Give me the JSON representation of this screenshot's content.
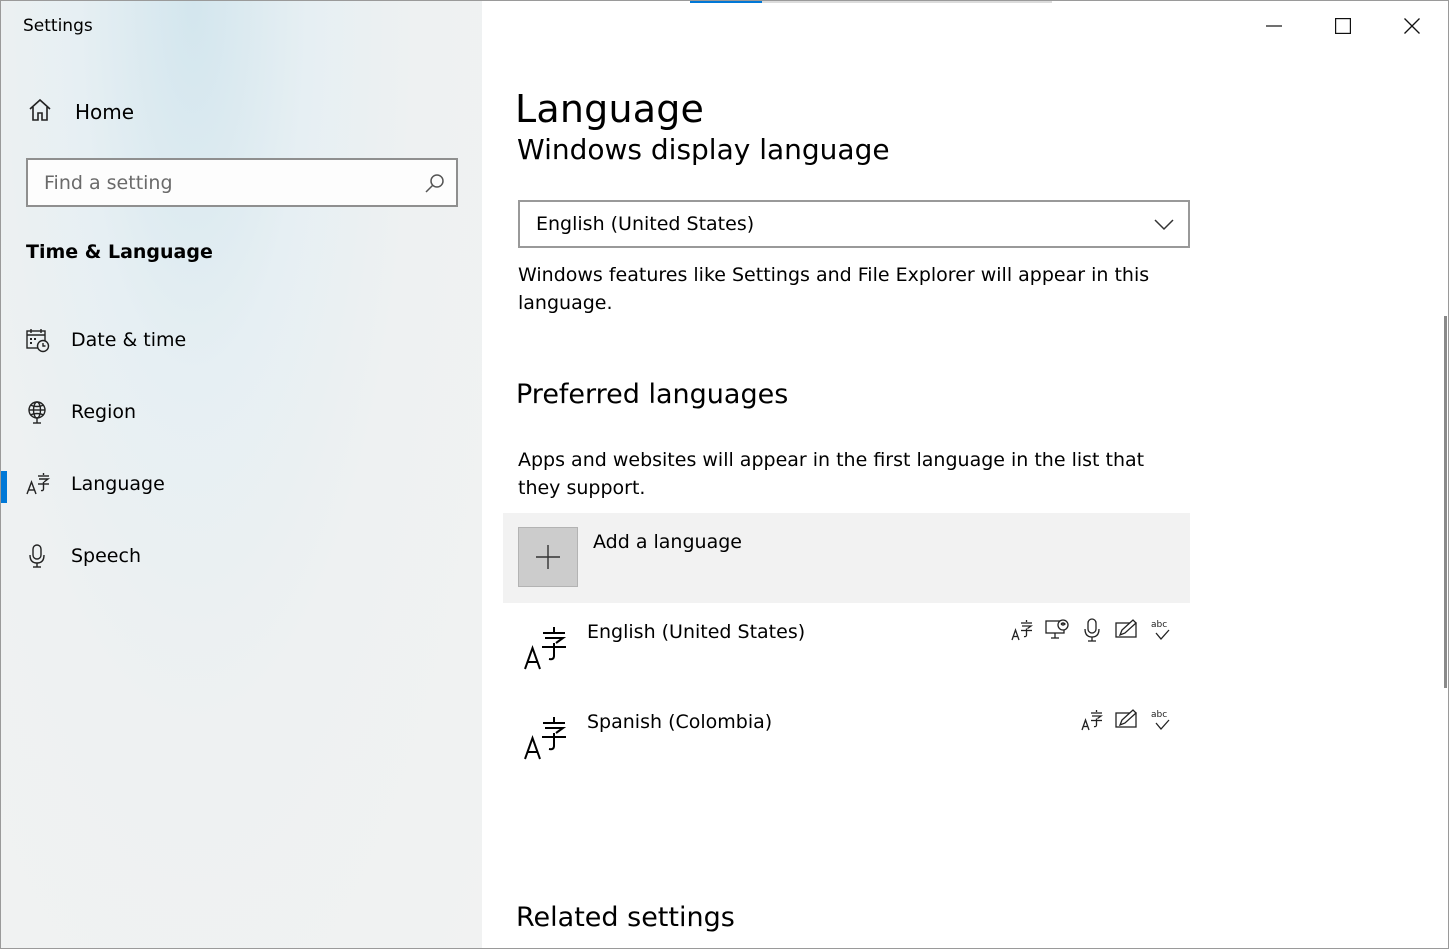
{
  "window": {
    "title": "Settings"
  },
  "sidebar": {
    "home_label": "Home",
    "search_placeholder": "Find a setting",
    "section_title": "Time & Language",
    "items": [
      {
        "label": "Date & time",
        "icon": "calendar-clock-icon"
      },
      {
        "label": "Region",
        "icon": "globe-icon"
      },
      {
        "label": "Language",
        "icon": "language-icon",
        "active": true
      },
      {
        "label": "Speech",
        "icon": "microphone-icon"
      }
    ]
  },
  "main": {
    "page_title": "Language",
    "display_language": {
      "heading": "Windows display language",
      "selected": "English (United States)",
      "description": "Windows features like Settings and File Explorer will appear in this language."
    },
    "preferred": {
      "heading": "Preferred languages",
      "description": "Apps and websites will appear in the first language in the list that they support.",
      "add_label": "Add a language",
      "languages": [
        {
          "name": "English (United States)",
          "features": [
            "language-pack-icon",
            "text-to-speech-icon",
            "speech-recognition-icon",
            "handwriting-icon",
            "spell-check-icon"
          ]
        },
        {
          "name": "Spanish (Colombia)",
          "features": [
            "language-pack-icon",
            "handwriting-icon",
            "spell-check-icon"
          ]
        }
      ]
    },
    "related_heading": "Related settings"
  },
  "colors": {
    "accent": "#0078d7"
  }
}
